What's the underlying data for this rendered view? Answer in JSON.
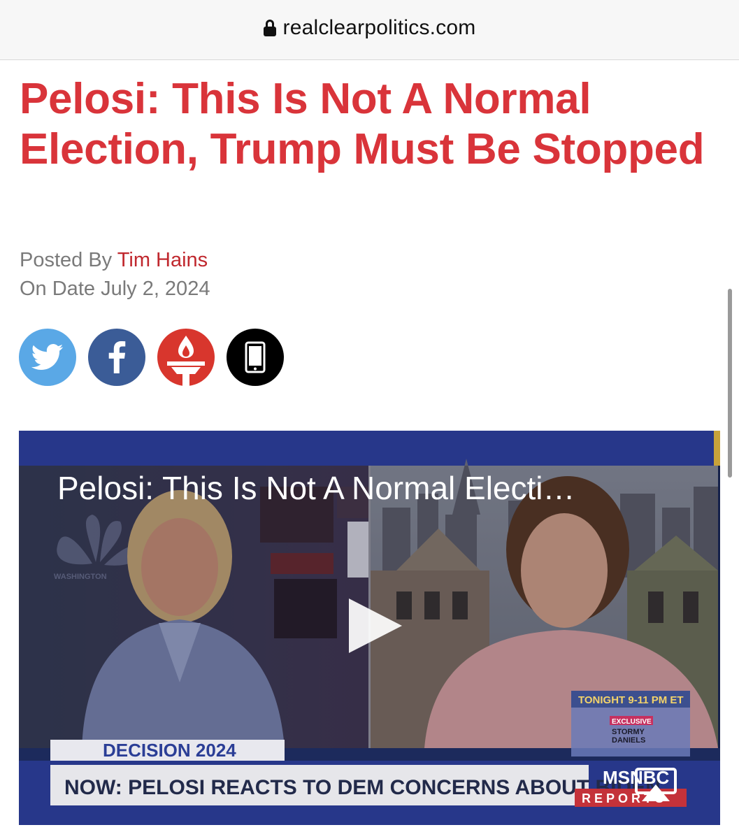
{
  "browser": {
    "url": "realclearpolitics.com",
    "lock_icon": "lock-icon"
  },
  "article": {
    "headline": "Pelosi: This Is Not A Normal Election, Trump Must Be Stopped",
    "posted_by_label": "Posted By",
    "author": "Tim Hains",
    "date_label": "On Date",
    "date": "July 2, 2024"
  },
  "share": [
    {
      "name": "twitter",
      "icon": "twitter-bird-icon",
      "color": "#5aa8e6"
    },
    {
      "name": "facebook",
      "icon": "facebook-f-icon",
      "color": "#3b5c97"
    },
    {
      "name": "rcp",
      "icon": "torch-icon",
      "color": "#d8362d"
    },
    {
      "name": "mobile",
      "icon": "mobile-phone-icon",
      "color": "#000000"
    }
  ],
  "video": {
    "title": "Pelosi: This Is Not A Normal Electi…",
    "play_icon": "play-icon",
    "airplay_icon": "airplay-icon",
    "chyron": {
      "decision_label": "DECISION 2024",
      "headline": "NOW: PELOSI REACTS TO DEM CONCERNS ABOUT BIDEN",
      "network": "MSNBC",
      "network_sub": "REPORTS",
      "promo_time": "TONIGHT 9-11 PM ET",
      "promo_badge": "EXCLUSIVE",
      "promo_name_1": "STORMY",
      "promo_name_2": "DANIELS",
      "studio_text": "WASHINGTON"
    }
  },
  "colors": {
    "headline_red": "#d9343a",
    "byline_gray": "#7a7a7a",
    "author_red": "#c0282e"
  }
}
